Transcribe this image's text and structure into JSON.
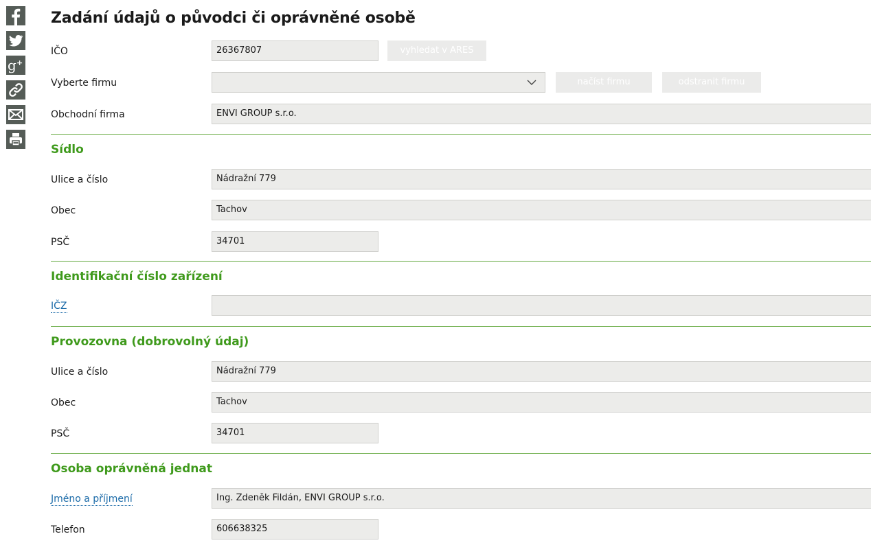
{
  "page": {
    "title": "Zadání údajů o původci či oprávněné osobě"
  },
  "social": [
    "facebook-icon",
    "twitter-icon",
    "google-plus-icon",
    "link-icon",
    "email-icon",
    "print-icon"
  ],
  "colors": {
    "accent": "#3f9a1c",
    "link": "#1a6aa8",
    "field_bg": "#ececea",
    "social_bg": "#555c57"
  },
  "company": {
    "ico_label": "IČO",
    "ico_value": "26367807",
    "ares_button": "vyhledat v ARES",
    "select_label": "Vyberte firmu",
    "select_value": "",
    "load_button": "načíst firmu",
    "remove_button": "odstranit firmu",
    "name_label": "Obchodní firma",
    "name_value": "ENVI GROUP s.r.o."
  },
  "seat": {
    "heading": "Sídlo",
    "street_label": "Ulice a číslo",
    "street_value": "Nádražní 779",
    "city_label": "Obec",
    "city_value": "Tachov",
    "zip_label": "PSČ",
    "zip_value": "34701"
  },
  "facility": {
    "heading": "Identifikační číslo zařízení",
    "icz_label": "IČZ",
    "icz_value": ""
  },
  "premises": {
    "heading": "Provozovna (dobrovolný údaj)",
    "street_label": "Ulice a číslo",
    "street_value": "Nádražní 779",
    "city_label": "Obec",
    "city_value": "Tachov",
    "zip_label": "PSČ",
    "zip_value": "34701"
  },
  "person": {
    "heading": "Osoba oprávněná jednat",
    "name_label": "Jméno a příjmení",
    "name_value": "Ing. Zdeněk Fildán, ENVI GROUP s.r.o.",
    "phone_label": "Telefon",
    "phone_value": "606638325"
  }
}
